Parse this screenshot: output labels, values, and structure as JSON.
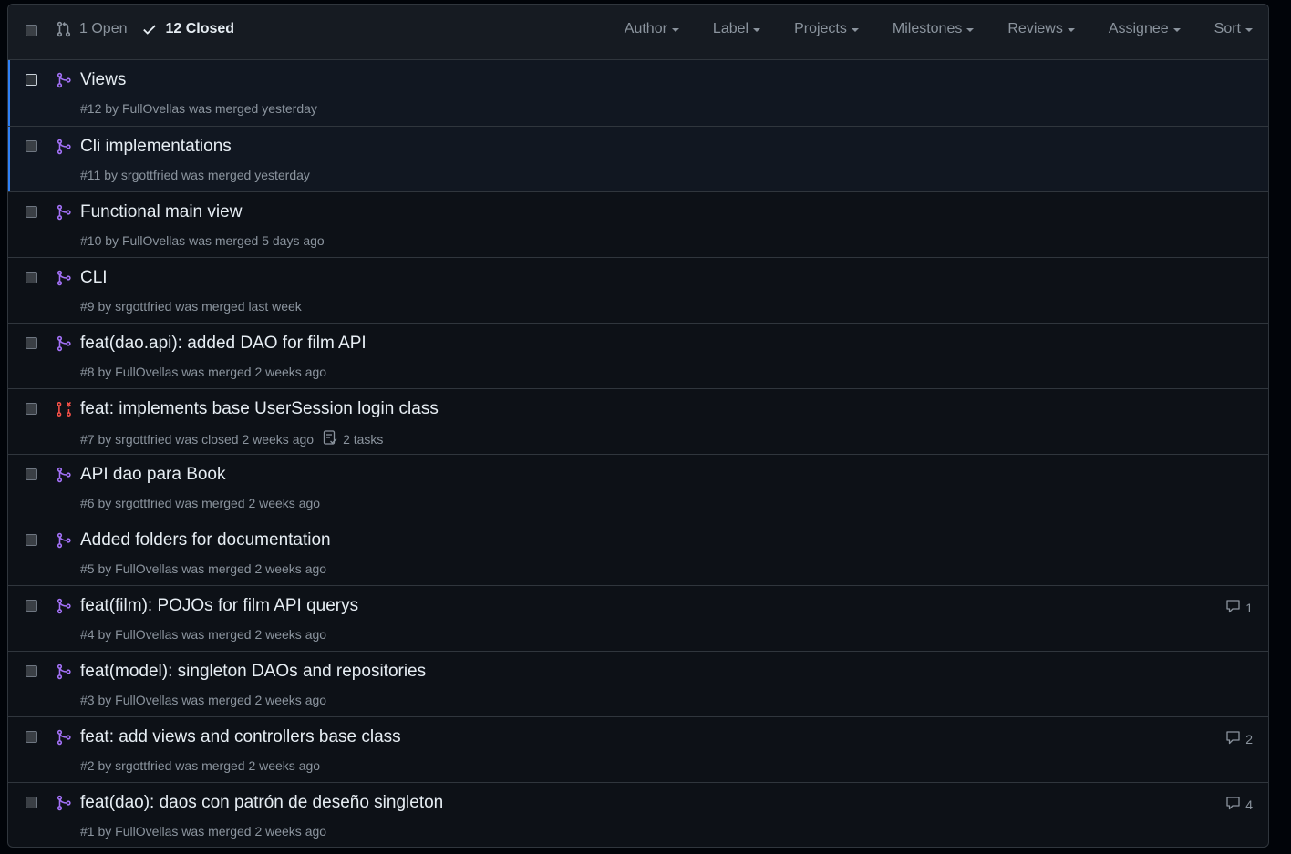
{
  "header": {
    "open_label": "1 Open",
    "closed_label": "12 Closed",
    "filters": [
      "Author",
      "Label",
      "Projects",
      "Milestones",
      "Reviews",
      "Assignee",
      "Sort"
    ]
  },
  "colors": {
    "merged": "#a371f7",
    "closed": "#f85149",
    "accent": "#2f81f7"
  },
  "pulls": [
    {
      "title": "Views",
      "number": "#12",
      "by": "by",
      "author": "FullOvellas",
      "status_text": "was merged yesterday",
      "state": "merged",
      "tasks": "",
      "comments": ""
    },
    {
      "title": "Cli implementations",
      "number": "#11",
      "by": "by",
      "author": "srgottfried",
      "status_text": "was merged yesterday",
      "state": "merged",
      "tasks": "",
      "comments": ""
    },
    {
      "title": "Functional main view",
      "number": "#10",
      "by": "by",
      "author": "FullOvellas",
      "status_text": "was merged 5 days ago",
      "state": "merged",
      "tasks": "",
      "comments": ""
    },
    {
      "title": "CLI",
      "number": "#9",
      "by": "by",
      "author": "srgottfried",
      "status_text": "was merged last week",
      "state": "merged",
      "tasks": "",
      "comments": ""
    },
    {
      "title": "feat(dao.api): added DAO for film API",
      "number": "#8",
      "by": "by",
      "author": "FullOvellas",
      "status_text": "was merged 2 weeks ago",
      "state": "merged",
      "tasks": "",
      "comments": ""
    },
    {
      "title": "feat: implements base UserSession login class",
      "number": "#7",
      "by": "by",
      "author": "srgottfried",
      "status_text": "was closed 2 weeks ago",
      "state": "closed",
      "tasks": "2 tasks",
      "comments": ""
    },
    {
      "title": "API dao para Book",
      "number": "#6",
      "by": "by",
      "author": "srgottfried",
      "status_text": "was merged 2 weeks ago",
      "state": "merged",
      "tasks": "",
      "comments": ""
    },
    {
      "title": "Added folders for documentation",
      "number": "#5",
      "by": "by",
      "author": "FullOvellas",
      "status_text": "was merged 2 weeks ago",
      "state": "merged",
      "tasks": "",
      "comments": ""
    },
    {
      "title": "feat(film): POJOs for film API querys",
      "number": "#4",
      "by": "by",
      "author": "FullOvellas",
      "status_text": "was merged 2 weeks ago",
      "state": "merged",
      "tasks": "",
      "comments": "1"
    },
    {
      "title": "feat(model): singleton DAOs and repositories",
      "number": "#3",
      "by": "by",
      "author": "FullOvellas",
      "status_text": "was merged 2 weeks ago",
      "state": "merged",
      "tasks": "",
      "comments": ""
    },
    {
      "title": "feat: add views and controllers base class",
      "number": "#2",
      "by": "by",
      "author": "srgottfried",
      "status_text": "was merged 2 weeks ago",
      "state": "merged",
      "tasks": "",
      "comments": "2"
    },
    {
      "title": "feat(dao): daos con patrón de deseño singleton",
      "number": "#1",
      "by": "by",
      "author": "FullOvellas",
      "status_text": "was merged 2 weeks ago",
      "state": "merged",
      "tasks": "",
      "comments": "4"
    }
  ]
}
